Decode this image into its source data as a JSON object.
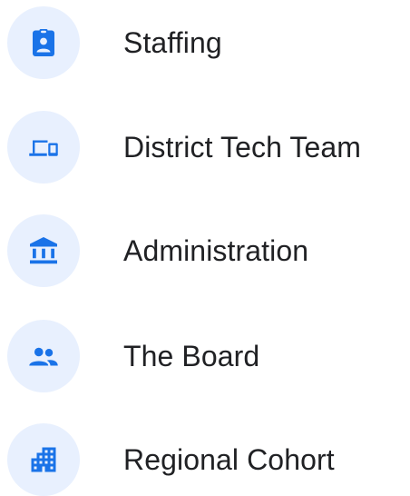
{
  "accent_color": "#1a73e8",
  "circle_color": "#e8f0fe",
  "text_color": "#202124",
  "items": [
    {
      "label": "Staffing",
      "icon": "badge-icon"
    },
    {
      "label": "District Tech Team",
      "icon": "devices-icon"
    },
    {
      "label": "Administration",
      "icon": "institution-icon"
    },
    {
      "label": "The Board",
      "icon": "group-icon"
    },
    {
      "label": "Regional Cohort",
      "icon": "apartment-icon"
    }
  ]
}
